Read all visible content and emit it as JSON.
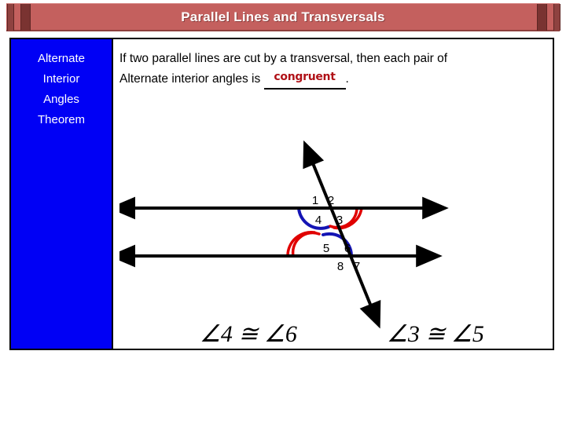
{
  "banner": {
    "title": "Parallel Lines and Transversals",
    "background_color": "#c4605e",
    "cap_color": "#7a3331",
    "text_color": "#ffffff"
  },
  "theorem_label": {
    "lines": [
      "Alternate",
      "Interior",
      "Angles",
      "Theorem"
    ],
    "background_color": "#0000f5",
    "text_color": "#ffffff"
  },
  "statement": {
    "line1": "If two parallel lines are cut by a transversal, then each pair of",
    "line2_before": "Alternate interior angles is ",
    "fill_in_answer": "congruent",
    "fill_in_color": "#b01117",
    "line2_after": "."
  },
  "diagram": {
    "angle_labels": [
      "1",
      "2",
      "3",
      "4",
      "5",
      "6",
      "7",
      "8"
    ],
    "arc_colors": {
      "blue": "#1414b4",
      "red": "#e00000"
    },
    "line_color": "#000000",
    "marked_angles_blue": [
      "4",
      "6"
    ],
    "marked_angles_red": [
      "3",
      "5"
    ]
  },
  "conclusions": {
    "left": "∠4 ≅ ∠6",
    "right": "∠3 ≅ ∠5"
  }
}
